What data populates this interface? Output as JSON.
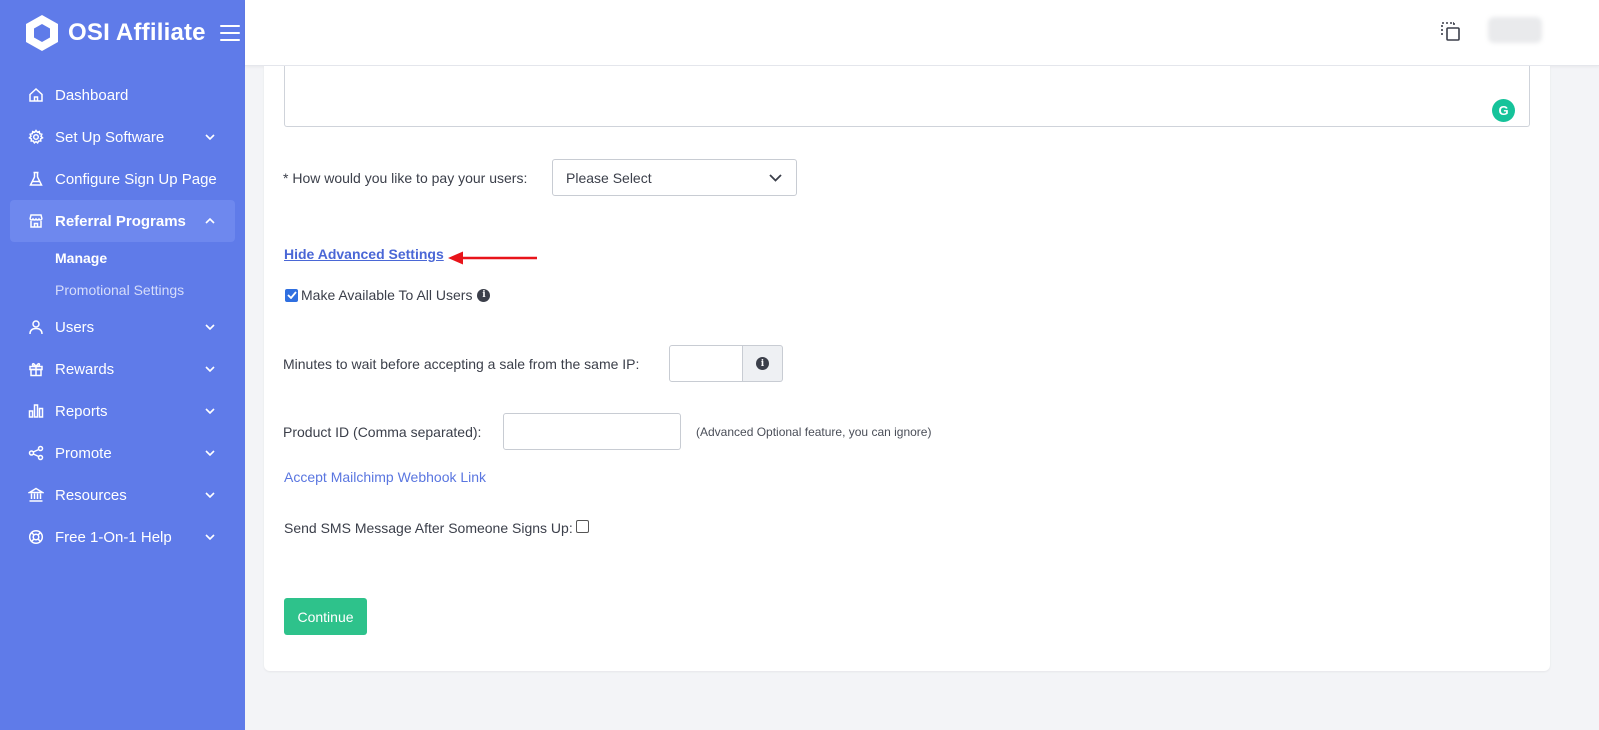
{
  "brand": {
    "name": "OSI Affiliate"
  },
  "sidebar": {
    "items": [
      {
        "label": "Dashboard",
        "icon": "home-icon"
      },
      {
        "label": "Set Up Software",
        "icon": "gear-icon"
      },
      {
        "label": "Configure Sign Up Page",
        "icon": "flask-icon"
      },
      {
        "label": "Referral Programs",
        "icon": "store-icon"
      },
      {
        "label": "Users",
        "icon": "user-icon"
      },
      {
        "label": "Rewards",
        "icon": "gift-icon"
      },
      {
        "label": "Reports",
        "icon": "bar-chart-icon"
      },
      {
        "label": "Promote",
        "icon": "share-icon"
      },
      {
        "label": "Resources",
        "icon": "bank-icon"
      },
      {
        "label": "Free 1-On-1 Help",
        "icon": "lifebuoy-icon"
      }
    ],
    "subitems": [
      {
        "label": "Manage"
      },
      {
        "label": "Promotional Settings"
      }
    ]
  },
  "form": {
    "pay_label": "* How would you like to pay your users:",
    "pay_select_value": "Please Select",
    "advanced_link": "Hide Advanced Settings",
    "make_available_label": "Make Available To All Users",
    "make_available_checked": true,
    "minutes_label": "Minutes to wait before accepting a sale from the same IP:",
    "minutes_value": "",
    "product_id_label": "Product ID (Comma separated):",
    "product_id_value": "",
    "product_id_note": "(Advanced Optional feature, you can ignore)",
    "mailchimp_link": "Accept Mailchimp Webhook Link",
    "sms_label": "Send SMS Message After Someone Signs Up:",
    "sms_checked": false,
    "continue_label": "Continue"
  },
  "colors": {
    "sidebar_bg": "#5f7be9",
    "link": "#4a67d6",
    "continue_button": "#2ec28b",
    "annotation_arrow": "#e8141a",
    "grammarly": "#15c39a"
  }
}
